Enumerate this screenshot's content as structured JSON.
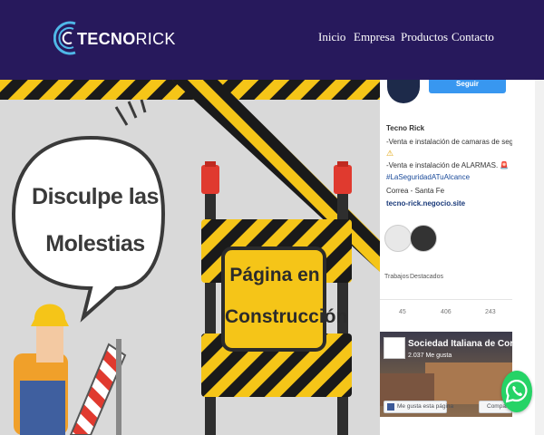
{
  "navbar": {
    "logo_text_bold": "TECNO",
    "logo_text_light": "RICK",
    "links": [
      "Inicio",
      "Empresa",
      "Productos",
      "Contacto"
    ]
  },
  "hero": {
    "bubble_line1": "Disculpe las",
    "bubble_line2": "Molestias",
    "sign_line1": "Página en",
    "sign_line2": "Construcción"
  },
  "instagram": {
    "follow_label": "Seguir",
    "name": "Tecno Rick",
    "bio_line1": "-Venta e instalación de camaras de seguridad.",
    "warning_glyph": "⚠",
    "bio_line2": "-Venta e instalación de ALARMAS. 🚨",
    "hashtag": "#LaSeguridadATuAlcance",
    "location": "Correa - Santa Fe",
    "website": "tecno-rick.negocio.site",
    "highlights": [
      "Trabajos",
      "Destacados"
    ],
    "stats": [
      "45",
      "406",
      "243"
    ]
  },
  "facebook": {
    "page_name": "Sociedad Italiana de Correa",
    "likes": "2.037 Me gusta",
    "like_button": "Me gusta esta página",
    "share_button": "Compar"
  },
  "colors": {
    "navbar_bg": "#27195c",
    "hazard_yellow": "#f5c518",
    "hazard_black": "#1a1a1a",
    "instagram_blue": "#3897f0",
    "whatsapp_green": "#25d366"
  },
  "icons": {
    "logo": "tecno-rick-logo-icon",
    "whatsapp": "whatsapp-icon"
  }
}
